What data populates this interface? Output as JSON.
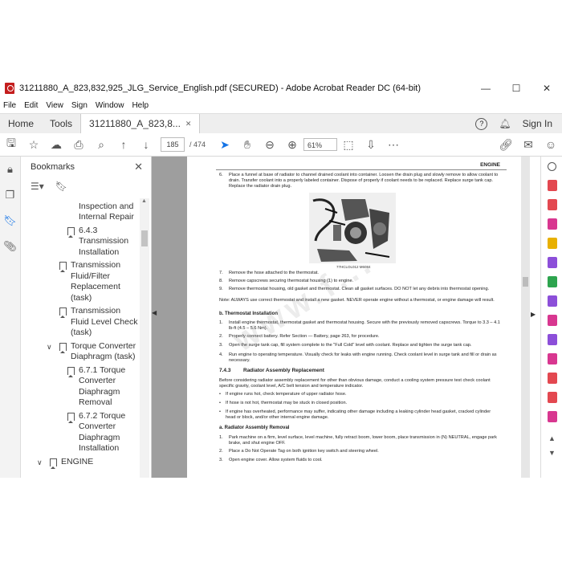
{
  "window": {
    "title": "31211880_A_823,832,925_JLG_Service_English.pdf (SECURED) - Adobe Acrobat Reader DC (64-bit)",
    "controls": [
      "—",
      "☐",
      "✕"
    ]
  },
  "menu": [
    "File",
    "Edit",
    "View",
    "Sign",
    "Window",
    "Help"
  ],
  "tabs": {
    "home": "Home",
    "tools": "Tools",
    "doc": "31211880_A_823,8...",
    "doc_close": "✕",
    "sign_in": "Sign In"
  },
  "toolbar": {
    "page_current": "185",
    "page_total": "/ 474",
    "zoom": "61%"
  },
  "bookmarks": {
    "title": "Bookmarks",
    "items": [
      {
        "label": "Transmission Inspection and Internal Repair",
        "indent": 2,
        "top_clip": true
      },
      {
        "label": "6.4.3 Transmission Installation",
        "indent": 2
      },
      {
        "label": "Transmission Fluid/Filter Replacement (task)",
        "indent": 1
      },
      {
        "label": "Transmission Fluid Level Check (task)",
        "indent": 1
      },
      {
        "label": "Torque Converter Diaphragm (task)",
        "indent": 1,
        "expanded": true
      },
      {
        "label": "6.7.1 Torque Converter Diaphragm Removal",
        "indent": 2
      },
      {
        "label": "6.7.2 Torque Converter Diaphragm Installation",
        "indent": 2
      },
      {
        "label": "ENGINE",
        "indent": 0,
        "expanded": true
      }
    ]
  },
  "page": {
    "header": "ENGINE",
    "step6": "Place a funnel at base of radiator to channel drained coolant into container. Loosen the drain plug and slowly remove to allow coolant to drain. Transfer coolant into a properly labeled container. Dispose of properly if coolant needs to be replaced. Replace surge tank cap. Replace the radiator drain plug.",
    "image_caption": "77HCLOL012 M6084",
    "step7": "Remove the hose attached to the thermostat.",
    "step8": "Remove capscrews securing thermostat housing (1) to engine.",
    "step9": "Remove thermostat housing, old gasket and thermostat. Clean all gasket surfaces. DO NOT let any debris into thermostat opening.",
    "note": "Note:  ALWAYS use correct thermostat and install a new gasket. NEVER operate engine without a thermostat, or engine damage will result.",
    "sub_b": "b. Thermostat Installation",
    "b1": "Install engine thermostat, thermostat gasket and thermostat housing. Secure with the previously removed capscrews. Torque to 3.3 – 4.1 lb-ft (4.5 – 5.6 Nm).",
    "b2": "Properly connect battery. Refer Section — Battery, page 263, for procedure.",
    "b3": "Open the surge tank cap, fill system complete to the \"Full Cold\" level with coolant. Replace and tighten the surge tank cap.",
    "b4": "Run engine to operating temperature. Visually check for leaks with engine running. Check coolant level in surge tank and fill or drain as necessary.",
    "sec_num": "7.4.3",
    "sec_title": "Radiator Assembly Replacement",
    "intro": "Before considering radiator assembly replacement for other than obvious damage, conduct a cooling system pressure test check coolant specific gravity, coolant level, A/C belt tension and temperature indicator.",
    "bul1": "If engine runs hot, check temperature of upper radiator hose.",
    "bul2": "If hose is not hot, thermostat may be stuck in closed position.",
    "bul3": "If engine has overheated, performance may suffer, indicating other damage including a leaking cylinder head gasket, cracked cylinder head or block, and/or other internal engine damage.",
    "sub_a": "a. Radiator Assembly Removal",
    "a1": "Park machine on a firm, level surface, level machine, fully retract boom, lower boom, place transmission in (N) NEUTRAL, engage park brake, and shut engine OFF.",
    "a2": "Place a Do Not Operate Tag on both ignition key switch and steering wheel.",
    "a3": "Open engine cover. Allow system fluids to cool."
  },
  "right_tools": [
    {
      "name": "search-tool-icon",
      "color": "#555555"
    },
    {
      "name": "export-pdf-icon",
      "color": "#e34850"
    },
    {
      "name": "create-pdf-icon",
      "color": "#e34850"
    },
    {
      "name": "edit-pdf-icon",
      "color": "#d83790"
    },
    {
      "name": "comment-icon",
      "color": "#e8b000"
    },
    {
      "name": "combine-icon",
      "color": "#8c4fd9"
    },
    {
      "name": "organize-icon",
      "color": "#2da44e"
    },
    {
      "name": "send-icon",
      "color": "#8c4fd9"
    },
    {
      "name": "redact-icon",
      "color": "#d83790"
    },
    {
      "name": "protect-icon",
      "color": "#8c4fd9"
    },
    {
      "name": "fill-sign-icon",
      "color": "#d83790"
    },
    {
      "name": "rich-media-icon",
      "color": "#e34850"
    },
    {
      "name": "more-tools-icon",
      "color": "#e34850"
    },
    {
      "name": "stamp-icon",
      "color": "#d83790"
    }
  ],
  "watermark": "www.f..."
}
